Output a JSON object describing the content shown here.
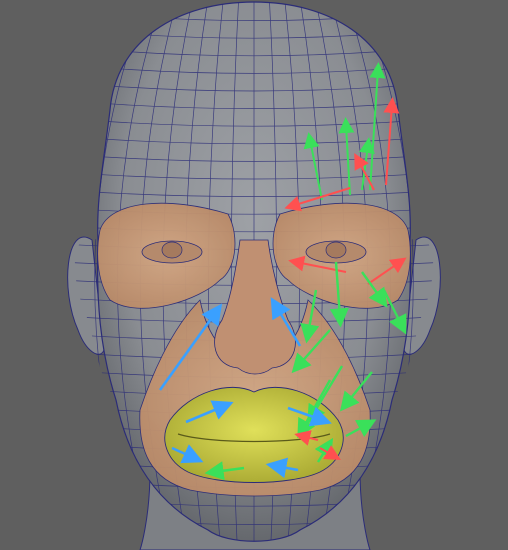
{
  "scene": {
    "subject": "face-topology-mesh",
    "colors": {
      "background": "#5f5f5f",
      "skin_gray": "#8c8f94",
      "skin_shadow": "#6c6f74",
      "mesh_line": "#2b2c78",
      "eye_mouth_region": "#c79a7a",
      "nose_region": "#b88a6e",
      "lips_region": "#c8c84a",
      "arrow_green": "#3ae05a",
      "arrow_red": "#ff5050",
      "arrow_blue": "#3aa0ff"
    },
    "layers": [
      {
        "name": "head-mesh",
        "color": "#8c8f94"
      },
      {
        "name": "eye-region-left",
        "color": "#c79a7a"
      },
      {
        "name": "eye-region-right",
        "color": "#c79a7a"
      },
      {
        "name": "nose",
        "color": "#b88a6e"
      },
      {
        "name": "mouth-surround",
        "color": "#c79a7a"
      },
      {
        "name": "lips",
        "color": "#c8c84a"
      }
    ],
    "arrow_groups": [
      {
        "name": "forehead-flow",
        "color": "#3ae05a"
      },
      {
        "name": "brow-flow",
        "color": "#ff5050"
      },
      {
        "name": "cheek-flow",
        "color": "#3ae05a"
      },
      {
        "name": "nasolabial-flow",
        "color": "#3aa0ff"
      },
      {
        "name": "lip-flow",
        "color": "#3ae05a"
      }
    ]
  }
}
